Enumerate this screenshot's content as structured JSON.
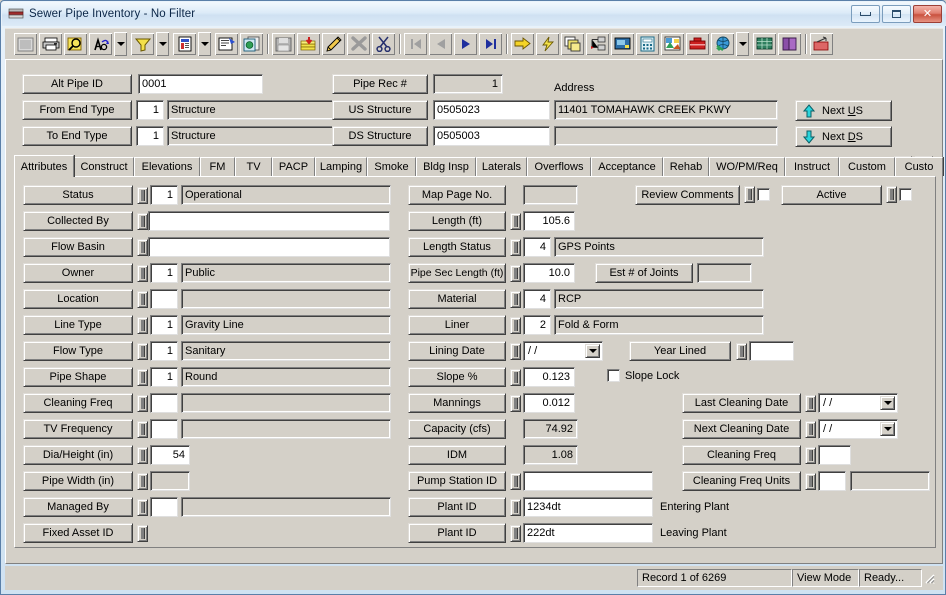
{
  "window": {
    "title": "Sewer Pipe Inventory - No Filter",
    "icon": "app-icon",
    "minimize_label": "",
    "maximize_label": "",
    "close_label": "✕"
  },
  "toolbar": {
    "buttons": [
      {
        "name": "print-preview-icon",
        "title": "Print Preview"
      },
      {
        "name": "print-icon",
        "title": "Print"
      },
      {
        "name": "search-zoom-icon",
        "title": "Find"
      },
      {
        "name": "find-replace-icon",
        "title": "Find/Replace"
      },
      {
        "name": "filter-icon",
        "title": "Filter"
      },
      {
        "name": "report-icon",
        "title": "Report"
      },
      {
        "name": "properties-icon",
        "title": "Properties"
      },
      {
        "name": "copy-record-icon",
        "title": "Copy Record"
      },
      {
        "name": "save-icon",
        "title": "Save"
      },
      {
        "name": "post-icon",
        "title": "Post"
      },
      {
        "name": "edit-pencil-icon",
        "title": "Edit"
      },
      {
        "name": "delete-x-icon",
        "title": "Delete"
      },
      {
        "name": "cut-scissors-icon",
        "title": "Cut"
      },
      {
        "name": "nav-first-icon",
        "title": "First Record"
      },
      {
        "name": "nav-prev-icon",
        "title": "Previous Record"
      },
      {
        "name": "nav-next-icon",
        "title": "Next Record"
      },
      {
        "name": "nav-last-icon",
        "title": "Last Record"
      },
      {
        "name": "goto-icon",
        "title": "Go To"
      },
      {
        "name": "lightning-icon",
        "title": "Quick Action"
      },
      {
        "name": "window-stack-icon",
        "title": "Windows"
      },
      {
        "name": "hierarchy-icon",
        "title": "Hierarchy"
      },
      {
        "name": "monitor-icon",
        "title": "Display"
      },
      {
        "name": "calculator-icon",
        "title": "Calculator"
      },
      {
        "name": "image-icon",
        "title": "Images"
      },
      {
        "name": "toolbox-icon",
        "title": "Tools"
      },
      {
        "name": "globe-icon",
        "title": "Map"
      },
      {
        "name": "grid-icon",
        "title": "Grid"
      },
      {
        "name": "book-icon",
        "title": "Help"
      },
      {
        "name": "exit-icon",
        "title": "Exit"
      }
    ]
  },
  "header": {
    "alt_pipe_id": {
      "label": "Alt Pipe ID",
      "value": "0001"
    },
    "from_end_type": {
      "label": "From End Type",
      "code": "1",
      "desc": "Structure"
    },
    "to_end_type": {
      "label": "To End Type",
      "code": "1",
      "desc": "Structure"
    },
    "pipe_rec": {
      "label": "Pipe Rec #",
      "value": "1"
    },
    "us_structure": {
      "label": "US Structure",
      "value": "0505023"
    },
    "ds_structure": {
      "label": "DS Structure",
      "value": "0505003"
    },
    "address_label": "Address",
    "address_line1": "11401    TOMAHAWK CREEK PKWY",
    "address_line2": "",
    "next_us": "Next US",
    "next_ds": "Next DS"
  },
  "tabs": {
    "items": [
      {
        "label": "Attributes",
        "selected": true
      },
      {
        "label": "Construct",
        "selected": false
      },
      {
        "label": "Elevations",
        "selected": false
      },
      {
        "label": "FM",
        "selected": false
      },
      {
        "label": "TV",
        "selected": false
      },
      {
        "label": "PACP",
        "selected": false
      },
      {
        "label": "Lamping",
        "selected": false
      },
      {
        "label": "Smoke",
        "selected": false
      },
      {
        "label": "Bldg Insp",
        "selected": false
      },
      {
        "label": "Laterals",
        "selected": false
      },
      {
        "label": "Overflows",
        "selected": false
      },
      {
        "label": "Acceptance",
        "selected": false
      },
      {
        "label": "Rehab",
        "selected": false
      },
      {
        "label": "WO/PM/Req",
        "selected": false
      },
      {
        "label": "Instruct",
        "selected": false
      },
      {
        "label": "Custom",
        "selected": false
      },
      {
        "label": "Custo",
        "selected": false
      }
    ],
    "scroll_left": "◄",
    "scroll_right": "►"
  },
  "attributes": {
    "left_column": [
      {
        "label": "Status",
        "code": "1",
        "desc": "Operational",
        "has_code": true,
        "desc_editable": true
      },
      {
        "label": "Collected By",
        "code": "",
        "desc": "",
        "has_code": false,
        "desc_editable": true
      },
      {
        "label": "Flow Basin",
        "code": "",
        "desc": "",
        "has_code": false,
        "desc_editable": true
      },
      {
        "label": "Owner",
        "code": "1",
        "desc": "Public",
        "has_code": true,
        "desc_editable": true
      },
      {
        "label": "Location",
        "code": "",
        "desc": "",
        "has_code": true,
        "desc_editable": false
      },
      {
        "label": "Line Type",
        "code": "1",
        "desc": "Gravity Line",
        "has_code": true,
        "desc_editable": true
      },
      {
        "label": "Flow Type",
        "code": "1",
        "desc": "Sanitary",
        "has_code": true,
        "desc_editable": true
      },
      {
        "label": "Pipe Shape",
        "code": "1",
        "desc": "Round",
        "has_code": true,
        "desc_editable": true
      },
      {
        "label": "Cleaning Freq",
        "code": "",
        "desc": "",
        "has_code": true,
        "desc_editable": false
      },
      {
        "label": "TV Frequency",
        "code": "",
        "desc": "",
        "has_code": true,
        "desc_editable": false
      },
      {
        "label": "Dia/Height (in)",
        "code": "54",
        "desc": null,
        "has_code": true,
        "desc_editable": false
      },
      {
        "label": "Pipe Width (in)",
        "code": "",
        "desc": null,
        "has_code": true,
        "desc_editable": false
      },
      {
        "label": "Managed By",
        "code": "",
        "desc": "",
        "has_code": true,
        "desc_editable": false
      },
      {
        "label": "Fixed Asset ID",
        "code": "",
        "desc": null,
        "has_code": false,
        "desc_editable": true
      }
    ],
    "middle_column": [
      {
        "label": "Map Page No.",
        "value": ""
      },
      {
        "label": "Length (ft)",
        "value": "105.6"
      },
      {
        "label": "Length Status",
        "code": "4",
        "desc": "GPS Points"
      },
      {
        "label": "Pipe Sec Length (ft)",
        "value": "10.0"
      },
      {
        "label": "Material",
        "code": "4",
        "desc": "RCP"
      },
      {
        "label": "Liner",
        "code": "2",
        "desc": "Fold & Form"
      },
      {
        "label": "Lining Date",
        "value": "/  /"
      },
      {
        "label": "Slope %",
        "value": "0.123"
      },
      {
        "label": "Mannings",
        "value": "0.012"
      },
      {
        "label": "Capacity (cfs)",
        "value": "74.92"
      },
      {
        "label": "IDM",
        "value": "1.08"
      },
      {
        "label": "Pump Station ID",
        "value": ""
      },
      {
        "label": "Plant ID",
        "value": "1234dt",
        "suffix": "Entering Plant"
      },
      {
        "label": "Plant ID",
        "value": "222dt",
        "suffix": "Leaving Plant"
      }
    ],
    "review_comments": {
      "label": "Review Comments",
      "checked": false
    },
    "active": {
      "label": "Active",
      "checked": false
    },
    "est_joints": {
      "label": "Est # of Joints",
      "value": ""
    },
    "year_lined": {
      "label": "Year Lined",
      "value": ""
    },
    "slope_lock": {
      "label": "Slope Lock",
      "checked": false
    },
    "right_column": [
      {
        "label": "Last Cleaning Date",
        "value": "/  /",
        "type": "date"
      },
      {
        "label": "Next Cleaning Date",
        "value": "/  /",
        "type": "date"
      },
      {
        "label": "Cleaning Freq",
        "value": "",
        "type": "small"
      },
      {
        "label": "Cleaning Freq Units",
        "code": "",
        "desc": "",
        "type": "coded"
      }
    ]
  },
  "statusbar": {
    "record": "Record 1 of 6269",
    "mode": "View Mode",
    "state": "Ready..."
  }
}
